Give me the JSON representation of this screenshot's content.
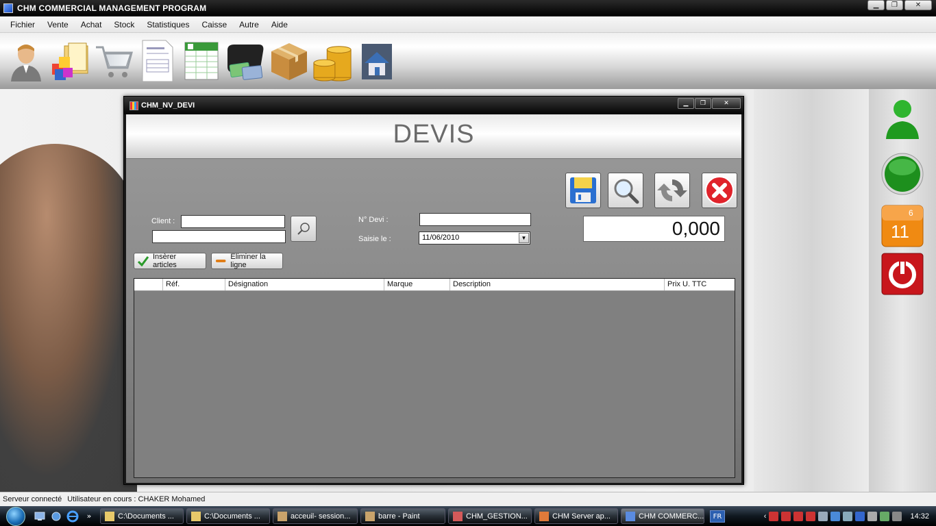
{
  "app": {
    "title": "CHM COMMERCIAL MANAGEMENT PROGRAM"
  },
  "window_buttons": {
    "minimize": "▁",
    "restore": "❐",
    "close": "✕"
  },
  "menu": [
    {
      "label": "Fichier"
    },
    {
      "label": "Vente"
    },
    {
      "label": "Achat"
    },
    {
      "label": "Stock"
    },
    {
      "label": "Statistiques"
    },
    {
      "label": "Caisse"
    },
    {
      "label": "Autre"
    },
    {
      "label": "Aide"
    }
  ],
  "toolbar": [
    {
      "icon": "user-icon"
    },
    {
      "icon": "products-folder-icon"
    },
    {
      "icon": "shopping-cart-icon"
    },
    {
      "icon": "document-form-icon"
    },
    {
      "icon": "spreadsheet-icon"
    },
    {
      "icon": "wallet-cards-icon"
    },
    {
      "icon": "cardboard-box-icon"
    },
    {
      "icon": "coins-icon"
    },
    {
      "icon": "house-icon"
    }
  ],
  "side_panel": {
    "calendar_month": "6",
    "calendar_day": "11"
  },
  "child_window": {
    "title": "CHM_NV_DEVI",
    "heading": "DEVIS",
    "client_label": "Client :",
    "client_code": "",
    "client_name": "",
    "devi_label": "N° Devi :",
    "devi_value": "",
    "date_label": "Saisie le :",
    "date_value": "11/06/2010",
    "total": "0,000",
    "insert_label": "Insèrer articles",
    "delete_label": "Eliminer la ligne",
    "columns": [
      "",
      "Réf.",
      "Désignation",
      "Marque",
      "Description",
      "Prix U. TTC"
    ]
  },
  "statusbar": {
    "server": "Serveur connecté",
    "user": "Utilisateur en cours : CHAKER Mohamed"
  },
  "taskbar": {
    "tasks": [
      {
        "label": "C:\\Documents ...",
        "color": "#e8c96a"
      },
      {
        "label": "C:\\Documents ...",
        "color": "#e8c96a"
      },
      {
        "label": "acceuil- session...",
        "color": "#c9a36b"
      },
      {
        "label": "barre - Paint",
        "color": "#c9a36b"
      },
      {
        "label": "CHM_GESTION...",
        "color": "#d45a5a"
      },
      {
        "label": "CHM Server ap...",
        "color": "#e07a3a"
      },
      {
        "label": "CHM COMMERC...",
        "color": "#5a8be0"
      }
    ],
    "lang": "FR",
    "clock": "14:32"
  }
}
